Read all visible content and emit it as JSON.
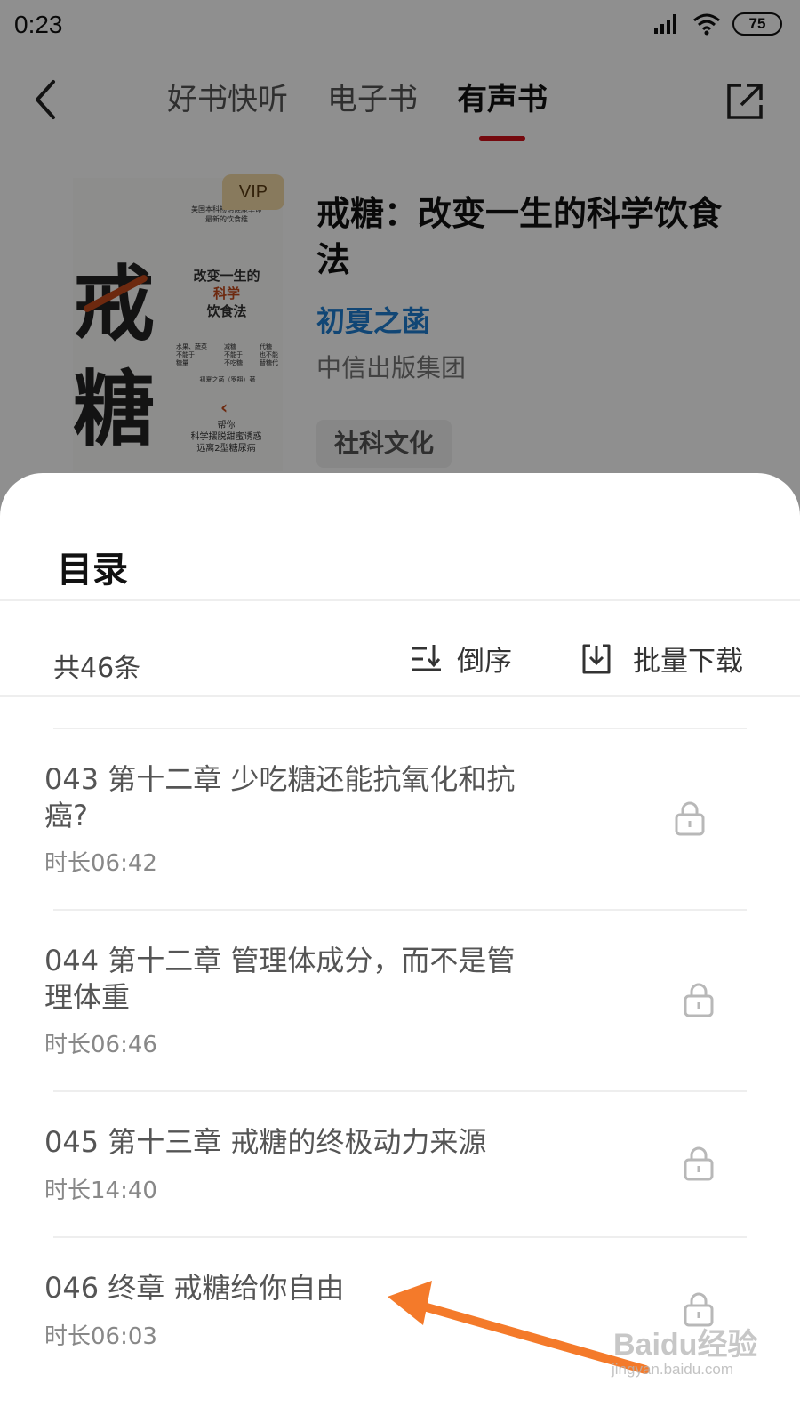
{
  "status_bar": {
    "time": "0:23",
    "battery": "75",
    "signal_icon": "signal-icon",
    "wifi_icon": "wifi-icon"
  },
  "header": {
    "tabs": [
      {
        "label": "好书快听",
        "active": false
      },
      {
        "label": "电子书",
        "active": false
      },
      {
        "label": "有声书",
        "active": true
      }
    ],
    "back_icon": "back-arrow-icon",
    "share_icon": "share-icon",
    "accent_color": "#d0101a"
  },
  "book": {
    "cover": {
      "big_char_1": "戒",
      "big_char_2": "糖",
      "top_small": "美国本科畅销健康革命\n最新的饮食维",
      "mid_line_1": "改变一生的",
      "mid_line_2": "科学",
      "mid_line_3": "饮食法",
      "col_1": "水果、蔬菜\n不能于\n糖量",
      "col_2": "减糖\n不能于\n不吃糖",
      "col_3": "代糖\n也不能\n替糖代",
      "author_line": "初夏之菡（罗翔）著",
      "bottom_line_1": "帮你",
      "bottom_line_2": "科学摆脱甜蜜诱惑",
      "bottom_line_3": "远离2型糖尿病"
    },
    "vip_label": "VIP",
    "title": "戒糖：改变一生的科学饮食法",
    "author": "初夏之菡",
    "author_color": "#1f7ed0",
    "publisher": "中信出版集团",
    "tag": "社科文化"
  },
  "catalog": {
    "title": "目录",
    "count_label": "共46条",
    "sort_label": "倒序",
    "sort_icon": "sort-icon",
    "download_label": "批量下载",
    "download_icon": "download-icon",
    "chapters": [
      {
        "title": "043 第十二章 少吃糖还能抗氧化和抗癌?",
        "duration": "时长06:42",
        "locked": true
      },
      {
        "title": "044 第十二章 管理体成分，而不是管理体重",
        "duration": "时长06:46",
        "locked": true
      },
      {
        "title": "045 第十三章 戒糖的终极动力来源",
        "duration": "时长14:40",
        "locked": true
      },
      {
        "title": "046 终章 戒糖给你自由",
        "duration": "时长06:03",
        "locked": true
      }
    ]
  },
  "annotation": {
    "arrow_color": "#f47a2a",
    "watermark": "Baidu经验",
    "watermark_sub": "jingyan.baidu.com"
  }
}
